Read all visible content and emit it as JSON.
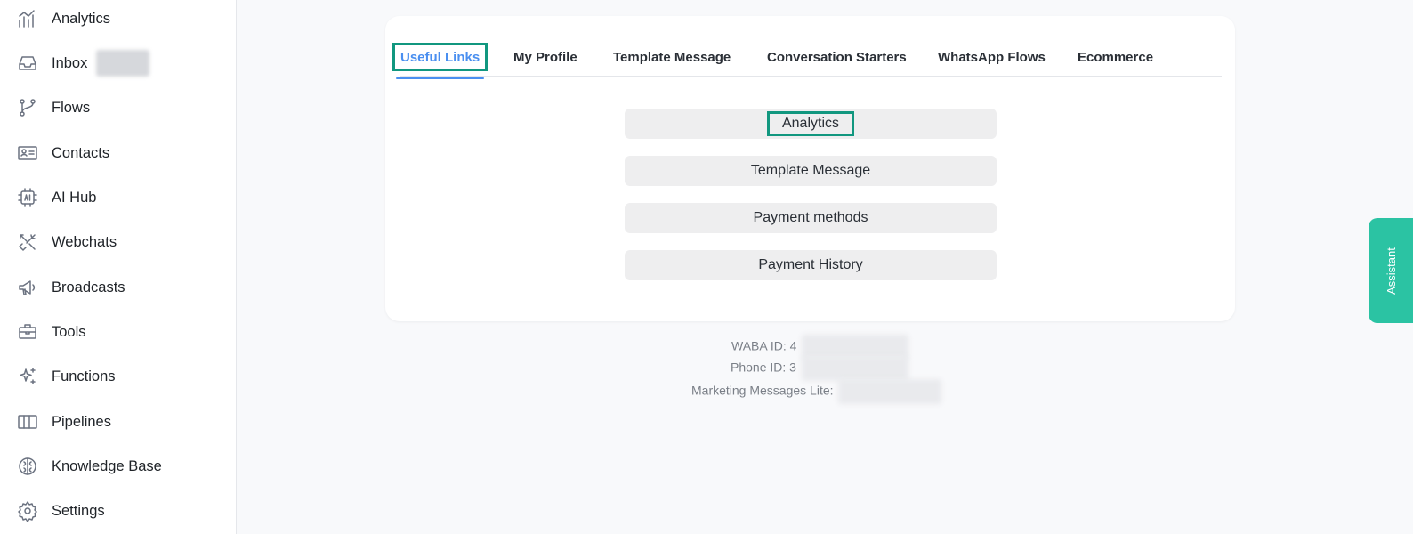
{
  "sidebar": {
    "items": [
      {
        "label": "Analytics",
        "icon": "analytics-icon"
      },
      {
        "label": "Inbox",
        "icon": "inbox-icon"
      },
      {
        "label": "Flows",
        "icon": "flows-icon"
      },
      {
        "label": "Contacts",
        "icon": "contacts-icon"
      },
      {
        "label": "AI Hub",
        "icon": "ai-hub-icon"
      },
      {
        "label": "Webchats",
        "icon": "webchats-icon"
      },
      {
        "label": "Broadcasts",
        "icon": "megaphone-icon"
      },
      {
        "label": "Tools",
        "icon": "toolbox-icon"
      },
      {
        "label": "Functions",
        "icon": "sparkle-icon"
      },
      {
        "label": "Pipelines",
        "icon": "pipelines-icon"
      },
      {
        "label": "Knowledge Base",
        "icon": "brain-icon"
      },
      {
        "label": "Settings",
        "icon": "gear-icon"
      }
    ]
  },
  "tabs": [
    {
      "label": "Useful Links",
      "active": true
    },
    {
      "label": "My Profile",
      "active": false
    },
    {
      "label": "Template Message",
      "active": false
    },
    {
      "label": "Conversation Starters",
      "active": false
    },
    {
      "label": "WhatsApp Flows",
      "active": false
    },
    {
      "label": "Ecommerce",
      "active": false
    }
  ],
  "links": [
    {
      "label": "Analytics"
    },
    {
      "label": "Template Message"
    },
    {
      "label": "Payment methods"
    },
    {
      "label": "Payment History"
    }
  ],
  "info": {
    "waba_label": "WABA ID: 4",
    "phone_label": "Phone ID: 3",
    "marketing_label": "Marketing Messages Lite:"
  },
  "assistant": {
    "label": "Assistant"
  },
  "colors": {
    "accent": "#4a8ff0",
    "highlight": "#11977f",
    "assistant": "#2bc3a3"
  }
}
